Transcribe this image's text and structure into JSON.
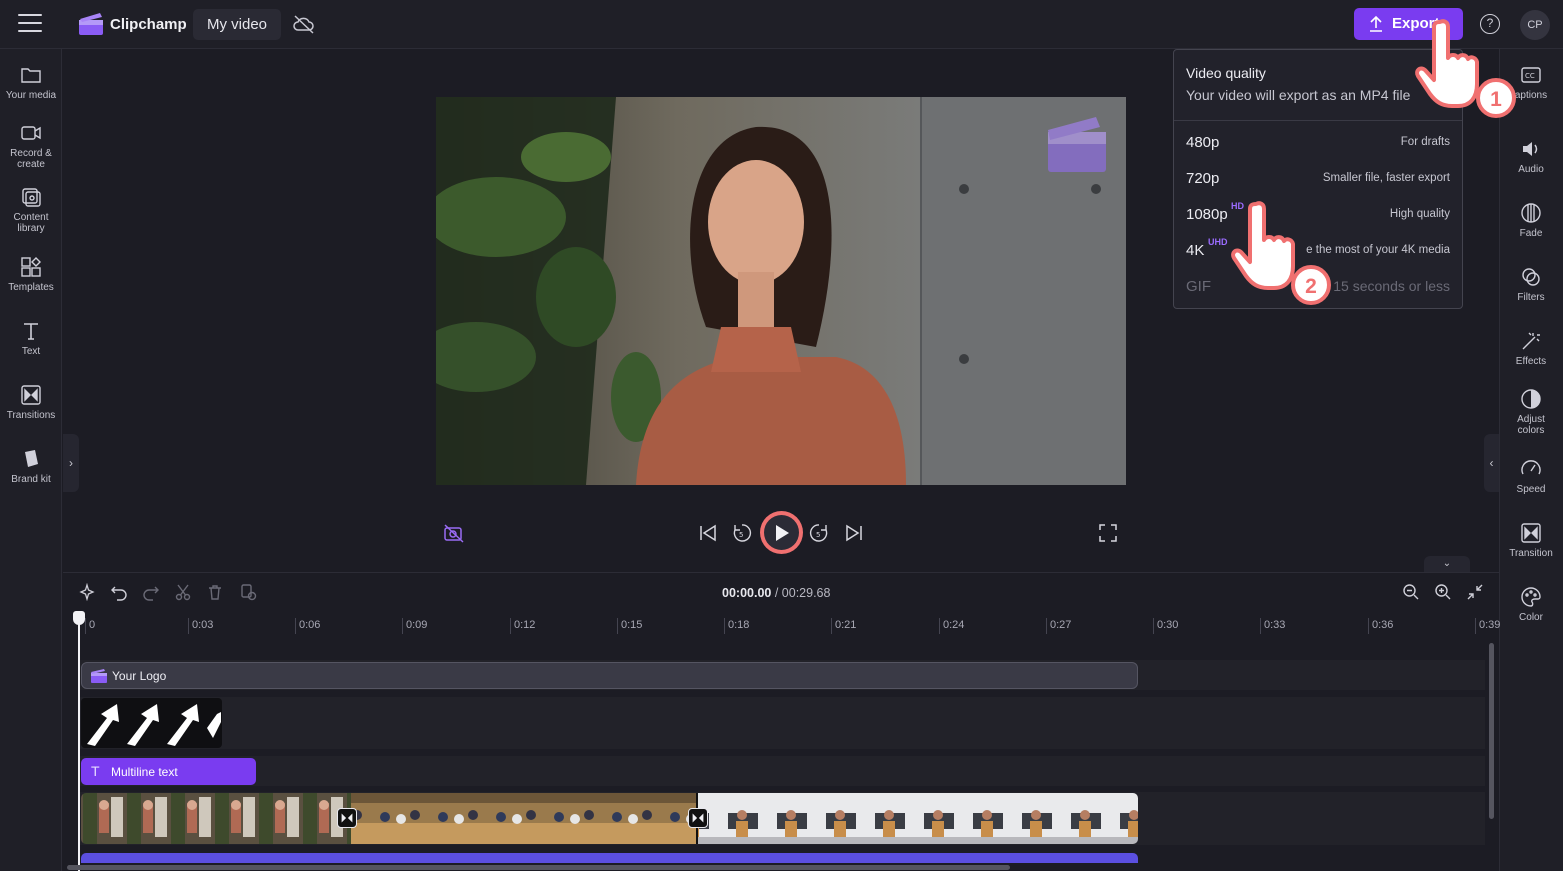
{
  "header": {
    "app_name": "Clipchamp",
    "project_name": "My video",
    "export_label": "Export",
    "help_symbol": "?",
    "avatar_initials": "CP"
  },
  "left_sidebar": {
    "items": [
      {
        "label": "Your media",
        "icon": "folder-icon"
      },
      {
        "label": "Record & create",
        "icon": "camera-icon"
      },
      {
        "label": "Content library",
        "icon": "library-icon"
      },
      {
        "label": "Templates",
        "icon": "templates-icon"
      },
      {
        "label": "Text",
        "icon": "text-icon"
      },
      {
        "label": "Transitions",
        "icon": "transitions-icon"
      },
      {
        "label": "Brand kit",
        "icon": "brand-kit-icon"
      }
    ]
  },
  "right_sidebar": {
    "items": [
      {
        "label": "aptions",
        "icon": "captions-icon"
      },
      {
        "label": "Audio",
        "icon": "audio-icon"
      },
      {
        "label": "Fade",
        "icon": "fade-icon"
      },
      {
        "label": "Filters",
        "icon": "filters-icon"
      },
      {
        "label": "Effects",
        "icon": "effects-icon"
      },
      {
        "label": "Adjust colors",
        "icon": "adjust-colors-icon"
      },
      {
        "label": "Speed",
        "icon": "speed-icon"
      },
      {
        "label": "Transition",
        "icon": "transition-icon"
      },
      {
        "label": "Color",
        "icon": "color-icon"
      }
    ]
  },
  "export_dropdown": {
    "title": "Video quality",
    "subtitle": "Your video will export as an MP4 file",
    "options": [
      {
        "name": "480p",
        "badge": "",
        "desc": "For drafts"
      },
      {
        "name": "720p",
        "badge": "",
        "desc": "Smaller file, faster export"
      },
      {
        "name": "1080p",
        "badge": "HD",
        "desc": "High quality"
      },
      {
        "name": "4K",
        "badge": "UHD",
        "desc": "e the most of your 4K media"
      },
      {
        "name": "GIF",
        "badge": "",
        "desc": "s 15 seconds or less"
      }
    ]
  },
  "annotations": {
    "step1": "1",
    "step2": "2"
  },
  "timeline": {
    "current_time": "00:00.00",
    "total_time": "/ 00:29.68",
    "ruler": [
      "0",
      "0:03",
      "0:06",
      "0:09",
      "0:12",
      "0:15",
      "0:18",
      "0:21",
      "0:24",
      "0:27",
      "0:30",
      "0:33",
      "0:36",
      "0:39"
    ],
    "tracks": {
      "logo_clip": "Your Logo",
      "text_clip": "Multiline text"
    }
  },
  "colors": {
    "accent": "#7a3cf0",
    "highlight": "#f07070",
    "badge": "#9b6cff"
  }
}
